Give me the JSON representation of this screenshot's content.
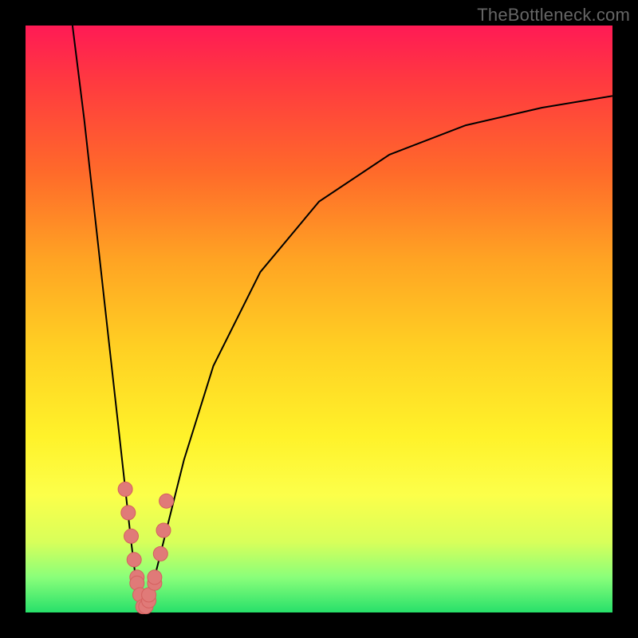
{
  "watermark": "TheBottleneck.com",
  "colors": {
    "background": "#000000",
    "gradient_top": "#ff1a55",
    "gradient_mid": "#ffd023",
    "gradient_bottom": "#27e06a",
    "curve": "#000000",
    "dot_fill": "#e07a78",
    "dot_stroke": "#d4605e"
  },
  "chart_data": {
    "type": "line",
    "title": "",
    "xlabel": "",
    "ylabel": "",
    "xlim": [
      0,
      100
    ],
    "ylim": [
      0,
      100
    ],
    "grid": false,
    "legend": false,
    "annotations": [
      "TheBottleneck.com"
    ],
    "series": [
      {
        "name": "bottleneck-curve-left",
        "x": [
          8,
          10,
          12,
          14,
          16,
          18,
          19,
          20
        ],
        "values": [
          100,
          84,
          66,
          48,
          30,
          12,
          4,
          0
        ]
      },
      {
        "name": "bottleneck-curve-right",
        "x": [
          20,
          22,
          24,
          27,
          32,
          40,
          50,
          62,
          75,
          88,
          100
        ],
        "values": [
          0,
          6,
          14,
          26,
          42,
          58,
          70,
          78,
          83,
          86,
          88
        ]
      }
    ],
    "markers": {
      "name": "sample-points",
      "x": [
        17,
        17.5,
        18,
        18.5,
        19,
        19,
        19.5,
        20,
        20.5,
        21,
        21,
        22,
        22,
        23,
        23.5,
        24
      ],
      "values": [
        21,
        17,
        13,
        9,
        6,
        5,
        3,
        1,
        1,
        2,
        3,
        5,
        6,
        10,
        14,
        19
      ]
    }
  }
}
